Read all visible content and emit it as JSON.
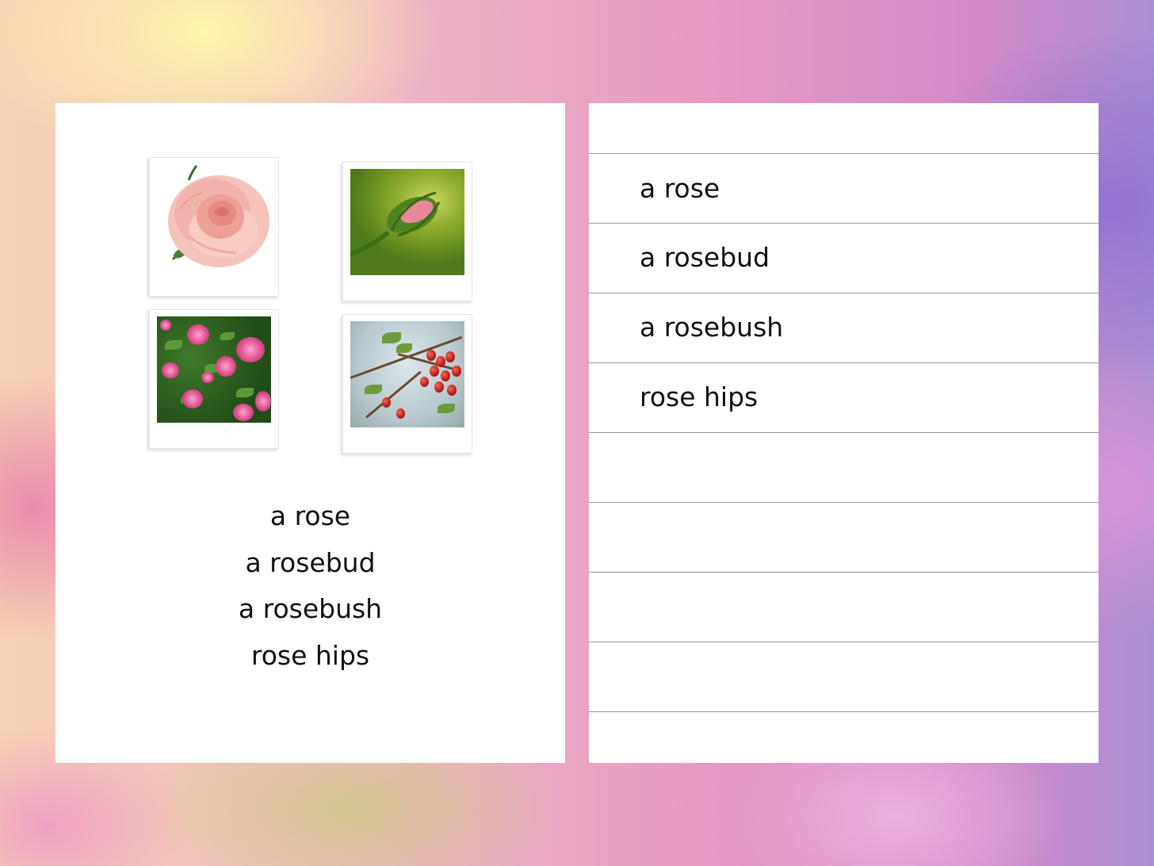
{
  "left_page": {
    "photos": [
      {
        "subject": "rose",
        "icon": "rose-photo-icon"
      },
      {
        "subject": "rosebud",
        "icon": "rosebud-photo-icon"
      },
      {
        "subject": "rosebush",
        "icon": "rosebush-photo-icon"
      },
      {
        "subject": "rose hips",
        "icon": "rose-hips-photo-icon"
      }
    ],
    "words": [
      "a rose",
      "a rosebud",
      "a rosebush",
      "rose hips"
    ]
  },
  "right_page": {
    "lines": [
      "a rose",
      "a rosebud",
      "a rosebush",
      "rose hips",
      "",
      "",
      "",
      "",
      ""
    ]
  }
}
